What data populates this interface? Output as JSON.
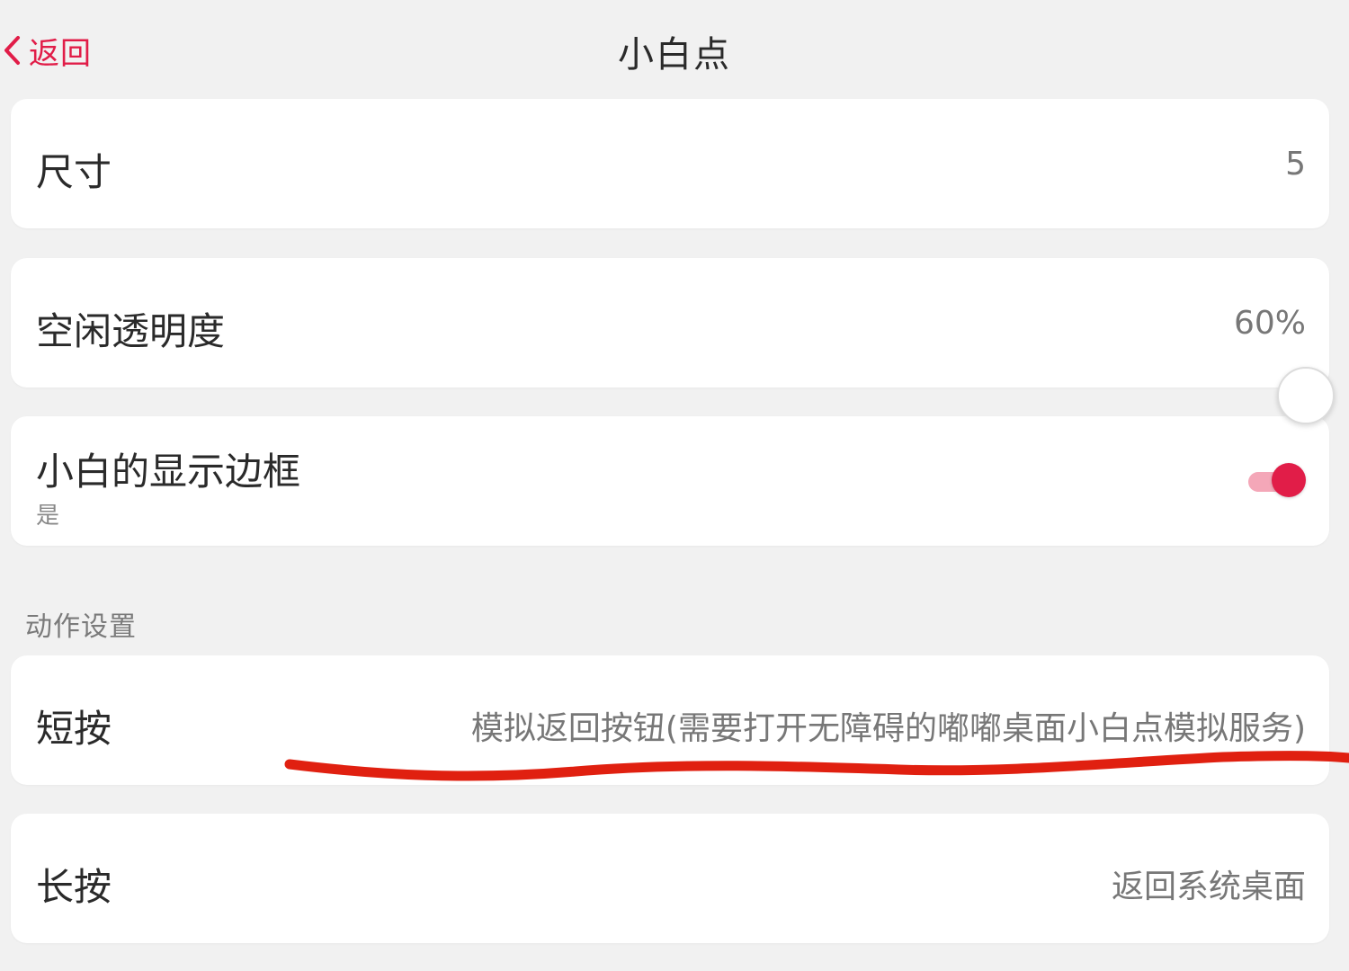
{
  "header": {
    "back_label": "返回",
    "title": "小白点"
  },
  "settings": {
    "size": {
      "label": "尺寸",
      "value": "5"
    },
    "idle_opacity": {
      "label": "空闲透明度",
      "value": "60%",
      "slider_level": 0.6
    },
    "show_border": {
      "label": "小白的显示边框",
      "sub": "是",
      "enabled": true
    }
  },
  "actions_section": {
    "title": "动作设置",
    "short_press": {
      "label": "短按",
      "value": "模拟返回按钮(需要打开无障碍的嘟嘟桌面小白点模拟服务)"
    },
    "long_press": {
      "label": "长按",
      "value": "返回系统桌面"
    }
  },
  "colors": {
    "accent": "#e11d48",
    "toggle_track": "#f4a7b8",
    "annotation_red": "#e02010",
    "background": "#f1f1f1",
    "card": "#ffffff"
  },
  "icons": {
    "back": "chevron-left-icon"
  }
}
